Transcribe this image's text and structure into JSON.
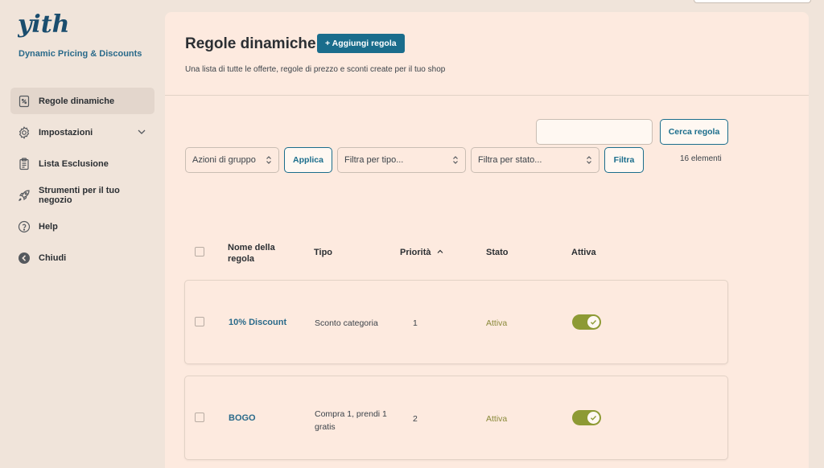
{
  "sidebar": {
    "brand": "Dynamic Pricing & Discounts",
    "logo_text": "yith",
    "items": [
      {
        "label": "Regole dinamiche",
        "icon": "discount-doc-icon"
      },
      {
        "label": "Impostazioni",
        "icon": "gear-icon"
      },
      {
        "label": "Lista Esclusione",
        "icon": "clipboard-list-icon"
      },
      {
        "label": "Strumenti per il tuo negozio",
        "icon": "rocket-icon"
      },
      {
        "label": "Help",
        "icon": "help-circle-icon"
      },
      {
        "label": "Chiudi",
        "icon": "close-circle-arrow-icon"
      }
    ]
  },
  "header": {
    "title": "Regole dinamiche",
    "add_label": "+ Aggiungi regola",
    "subtitle": "Una lista di tutte le offerte, regole di prezzo e sconti create per il tuo shop"
  },
  "filters": {
    "search_button": "Cerca regola",
    "bulk_actions": "Azioni di gruppo",
    "apply": "Applica",
    "filter_type": "Filtra per tipo...",
    "filter_status": "Filtra per stato...",
    "filter": "Filtra",
    "count": "16 elementi"
  },
  "table": {
    "headers": {
      "name": "Nome della regola",
      "type": "Tipo",
      "priority": "Priorità",
      "status": "Stato",
      "active": "Attiva"
    },
    "rows": [
      {
        "name": "10% Discount",
        "type": "Sconto categoria",
        "priority": "1",
        "status": "Attiva",
        "active": true
      },
      {
        "name": "BOGO",
        "type": "Compra 1, prendi 1 gratis",
        "priority": "2",
        "status": "Attiva",
        "active": true
      }
    ]
  },
  "colors": {
    "accent": "#1a6d8c",
    "toggle_on": "#8d9a34",
    "background": "#f0e4da",
    "panel": "#fdeadf"
  }
}
